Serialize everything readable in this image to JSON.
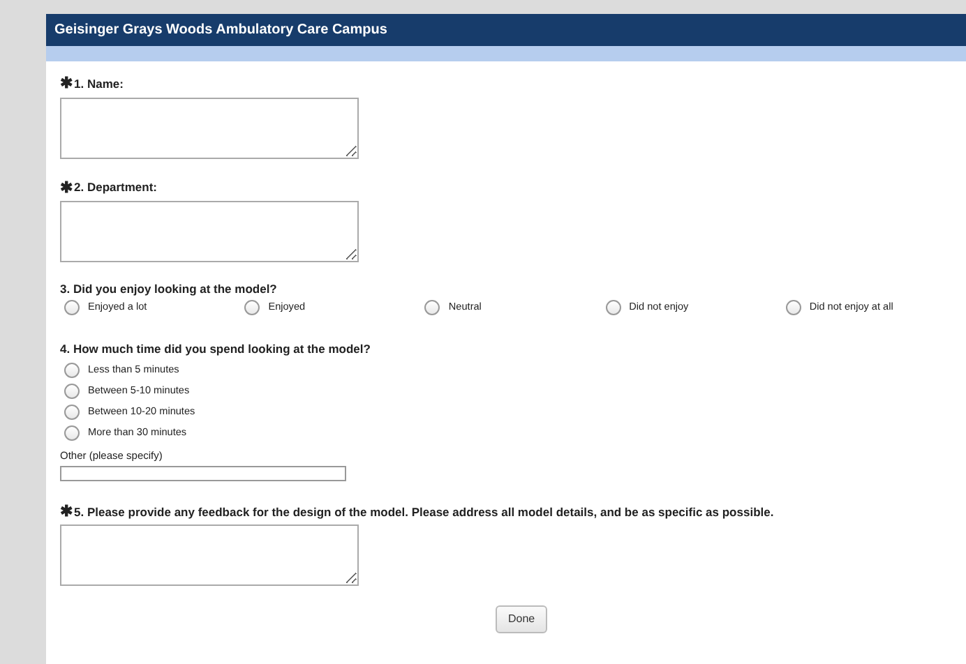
{
  "header": {
    "title": "Geisinger Grays Woods Ambulatory Care Campus"
  },
  "questions": [
    {
      "kind": "textarea",
      "marker": "✱",
      "label": "1. Name:"
    },
    {
      "kind": "textarea",
      "marker": "✱",
      "label": "2. Department:"
    },
    {
      "kind": "radio-row",
      "label": "3. Did you enjoy looking at the model?",
      "options": [
        {
          "label": "Enjoyed a lot",
          "selected": false
        },
        {
          "label": "Enjoyed",
          "selected": false
        },
        {
          "label": "Neutral",
          "selected": false
        },
        {
          "label": "Did not enjoy",
          "selected": false
        },
        {
          "label": "Did not enjoy at all",
          "selected": false
        }
      ]
    },
    {
      "kind": "radio-list",
      "label": "4. How much time did you spend looking at the model?",
      "options": [
        {
          "label": "Less than 5 minutes",
          "selected": false
        },
        {
          "label": "Between 5-10 minutes",
          "selected": false
        },
        {
          "label": "Between 10-20 minutes",
          "selected": false
        },
        {
          "label": "More than 30 minutes",
          "selected": false
        }
      ],
      "other": {
        "label": "Other (please specify)"
      }
    },
    {
      "kind": "textarea",
      "marker": "✱",
      "label": "5. Please provide any feedback for the design of the model. Please address all model details, and be as specific as possible."
    }
  ],
  "done_button": "Done"
}
